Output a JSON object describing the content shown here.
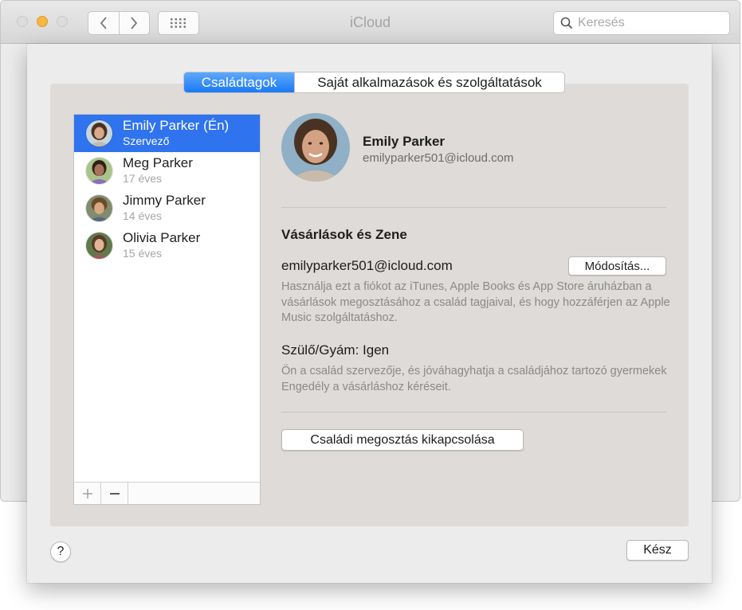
{
  "window": {
    "title": "iCloud"
  },
  "search": {
    "placeholder": "Keresés"
  },
  "tabs": [
    {
      "label": "Családtagok",
      "active": true
    },
    {
      "label": "Saját alkalmazások és szolgáltatások",
      "active": false
    }
  ],
  "members": [
    {
      "name": "Emily Parker (Én)",
      "subtitle": "Szervező",
      "selected": true
    },
    {
      "name": "Meg Parker",
      "subtitle": "17 éves",
      "selected": false
    },
    {
      "name": "Jimmy Parker",
      "subtitle": "14 éves",
      "selected": false
    },
    {
      "name": "Olivia Parker",
      "subtitle": "15 éves",
      "selected": false
    }
  ],
  "list_footer": {
    "add_symbol": "+",
    "remove_symbol": "−"
  },
  "detail": {
    "name": "Emily Parker",
    "email": "emilyparker501@icloud.com",
    "purchases": {
      "title": "Vásárlások és Zene",
      "account": "emilyparker501@icloud.com",
      "modify_label": "Módosítás...",
      "description": "Használja ezt a fiókot az iTunes, Apple Books és App Store áruházban a vásárlások megosztásához a család tagjaival, és hogy hozzáférjen az Apple Music szolgáltatáshoz."
    },
    "guardian": {
      "label": "Szülő/Gyám: Igen",
      "description": "Ön a család szervezője, és jóváhagyhatja a családjához tartozó gyermekek Engedély a vásárláshoz kéréseit."
    },
    "disable_label": "Családi megosztás kikapcsolása"
  },
  "footer": {
    "help_label": "?",
    "done_label": "Kész"
  },
  "colors": {
    "accent": "#2f73ef",
    "tab_active": "#1a79f4",
    "minimize": "#f5b642"
  }
}
